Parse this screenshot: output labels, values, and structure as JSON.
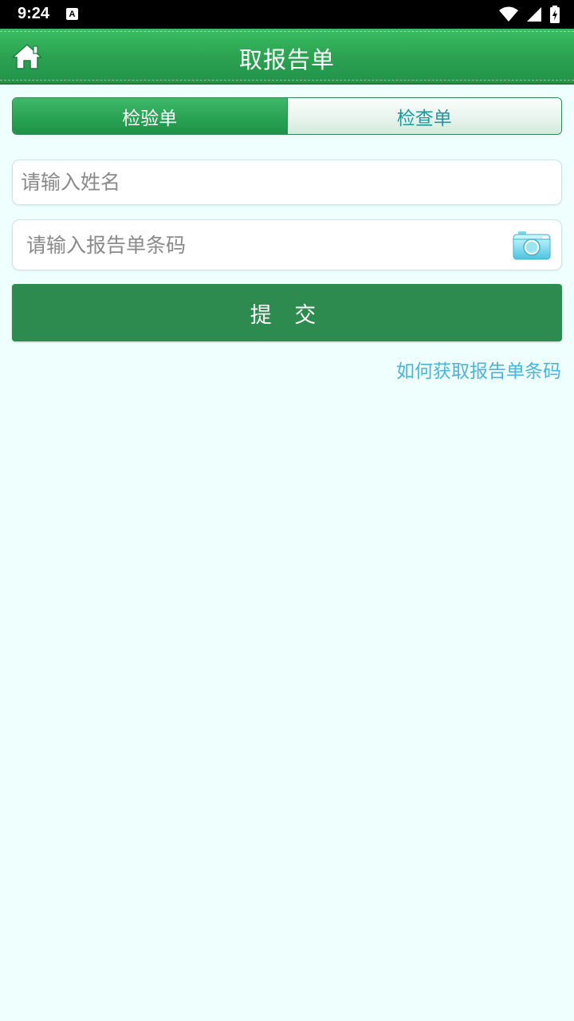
{
  "status_bar": {
    "time": "9:24",
    "notification_glyph": "A",
    "icons": [
      "wifi-icon",
      "signal-icon",
      "battery-icon"
    ]
  },
  "header": {
    "title": "取报告单",
    "home_icon": "home-icon"
  },
  "tabs": [
    {
      "label": "检验单",
      "active": true
    },
    {
      "label": "检查单",
      "active": false
    }
  ],
  "form": {
    "name_placeholder": "请输入姓名",
    "name_value": "",
    "barcode_placeholder": "请输入报告单条码",
    "barcode_value": "",
    "camera_icon": "camera-icon",
    "submit_label": "提 交"
  },
  "help_link": "如何获取报告单条码",
  "colors": {
    "header_green": "#2aa150",
    "button_green": "#2e8b4f",
    "inactive_tab_text": "#1b9aa0",
    "link_blue": "#4db3dc",
    "page_background": "#eefffe"
  }
}
